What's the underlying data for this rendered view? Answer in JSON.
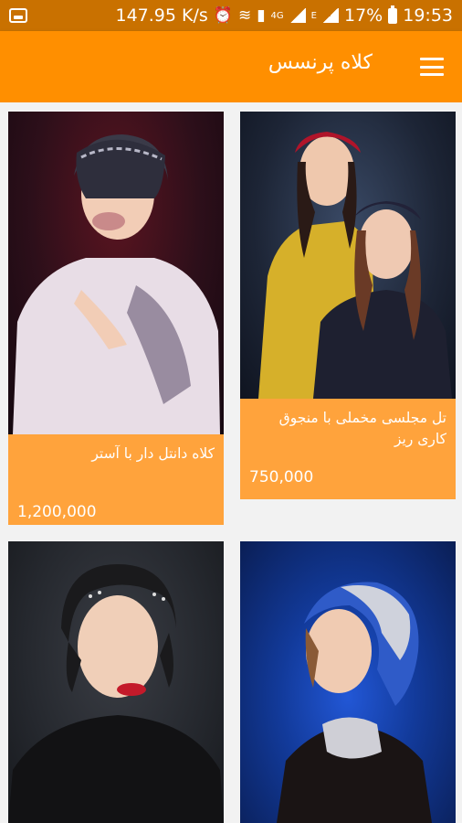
{
  "status_bar": {
    "speed": "147.95 K/s",
    "network_badge": "4G",
    "e_badge": "E",
    "battery": "17%",
    "time": "19:53",
    "icons": [
      "image-icon",
      "alarm-icon",
      "wifi-icon",
      "sim-icon",
      "signal-icon",
      "signal-icon",
      "battery-icon"
    ]
  },
  "app_bar": {
    "title": "کلاه پرنسس",
    "menu_icon": "hamburger-menu-icon"
  },
  "products": [
    {
      "title": "تل مجلسی مخملی با منجوق کاری ریز",
      "price": "750,000"
    },
    {
      "title": "کلاه دانتل دار با آستر",
      "price": "1,200,000"
    },
    {
      "title": "",
      "price": ""
    },
    {
      "title": "",
      "price": ""
    }
  ],
  "colors": {
    "status_bar": "#c97100",
    "app_bar": "#ff8f00",
    "card": "#ffa33c",
    "background": "#f2f2f2"
  }
}
